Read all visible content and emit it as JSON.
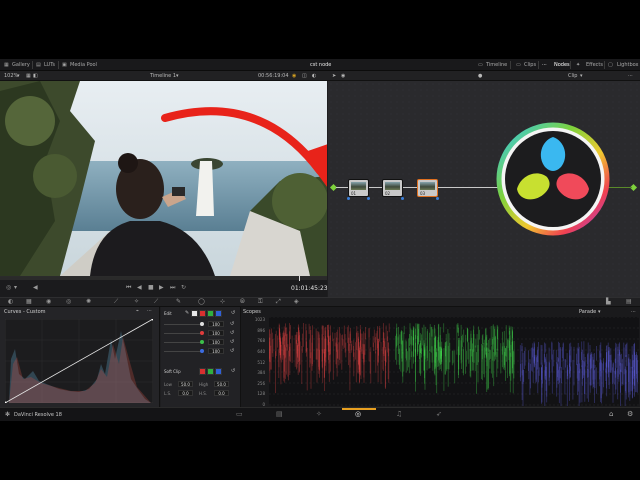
{
  "topbar": {
    "gallery": "Gallery",
    "luts": "LUTs",
    "media_pool": "Media Pool",
    "project_title": "cst node",
    "timeline": "Timeline",
    "clips": "Clips",
    "nodes": "Nodes",
    "effects": "Effects",
    "lightbox": "Lightbox"
  },
  "subbar": {
    "zoom": "102%",
    "timeline_name": "Timeline 1",
    "source_timecode": "00:56:19:04",
    "clip_mode": "Clip"
  },
  "transport": {
    "timecode": "01:01:45:23"
  },
  "nodes": {
    "items": [
      {
        "label": "01"
      },
      {
        "label": "02"
      },
      {
        "label": "03"
      }
    ]
  },
  "curves": {
    "title": "Curves - Custom"
  },
  "edit_panel": {
    "edit_label": "Edit",
    "soft_clip_label": "Soft Clip",
    "channels": [
      {
        "value": "100",
        "color": "#e0e0e0"
      },
      {
        "value": "100",
        "color": "#e03c3c"
      },
      {
        "value": "100",
        "color": "#3cc04a"
      },
      {
        "value": "100",
        "color": "#3c6ce0"
      }
    ],
    "low_label": "Low",
    "low_value": "50.0",
    "high_label": "High",
    "high_value": "50.0",
    "ls_label": "L.S.",
    "ls_value": "0.0",
    "hs_label": "H.S.",
    "hs_value": "0.0"
  },
  "scopes": {
    "title": "Scopes",
    "mode": "Parade",
    "scale": [
      "1023",
      "896",
      "768",
      "640",
      "512",
      "384",
      "256",
      "128",
      "0"
    ],
    "colors": {
      "red": "#ff4a4a",
      "green": "#4aff5a",
      "blue": "#6a6aff"
    }
  },
  "bottombar": {
    "app_name": "DaVinci Resolve 18"
  },
  "brand_colors": {
    "ui_bg": "#1e1e20",
    "node_bg": "#2a2a2d",
    "arrow_red": "#e8231a",
    "active_page": "#e8a020"
  },
  "icons": [
    "gallery-icon",
    "luts-icon",
    "media-pool-icon",
    "timeline-icon",
    "clips-icon",
    "nodes-icon",
    "effects-icon",
    "lightbox-icon",
    "play-icon",
    "stop-icon",
    "skip-back-icon",
    "skip-forward-icon",
    "loop-icon",
    "davinci-logo-icon",
    "color-page-icon",
    "fusion-page-icon",
    "audio-page-icon",
    "deliver-page-icon",
    "home-icon",
    "settings-icon"
  ]
}
